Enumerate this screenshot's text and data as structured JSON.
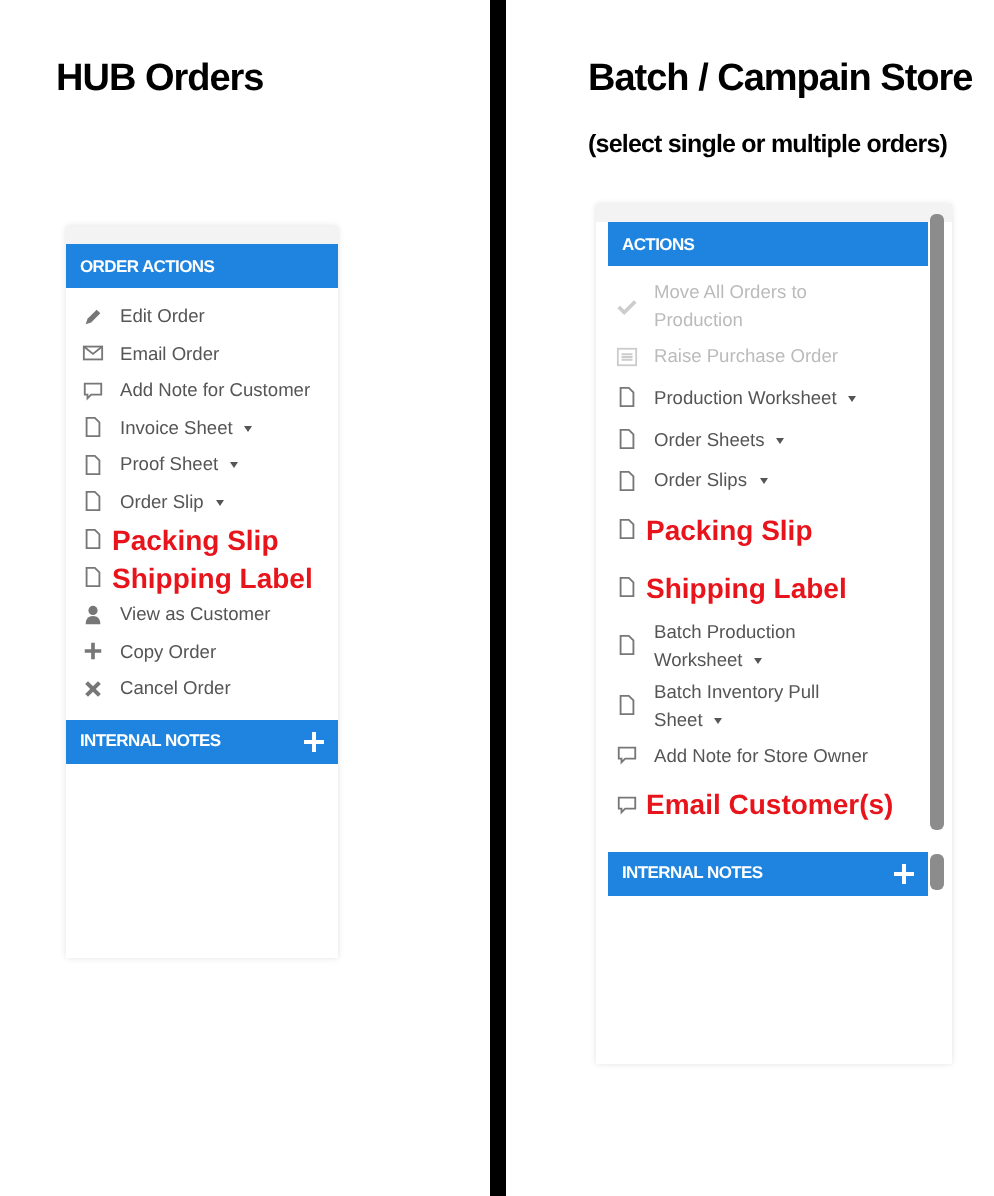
{
  "hub": {
    "title": "HUB Orders",
    "panel": {
      "header": "ORDER ACTIONS",
      "items": [
        {
          "kind": "pencil",
          "label": "Edit Order",
          "has_menu": false,
          "emphasis": false,
          "disabled": false
        },
        {
          "kind": "envelope",
          "label": "Email Order",
          "has_menu": false,
          "emphasis": false,
          "disabled": false
        },
        {
          "kind": "comment",
          "label": "Add Note for Customer",
          "has_menu": false,
          "emphasis": false,
          "disabled": false
        },
        {
          "kind": "document",
          "label": "Invoice Sheet",
          "has_menu": true,
          "emphasis": false,
          "disabled": false
        },
        {
          "kind": "document",
          "label": "Proof Sheet",
          "has_menu": true,
          "emphasis": false,
          "disabled": false
        },
        {
          "kind": "document",
          "label": "Order Slip",
          "has_menu": true,
          "emphasis": false,
          "disabled": false
        },
        {
          "kind": "document",
          "label": "Packing Slip",
          "has_menu": false,
          "emphasis": true,
          "disabled": false
        },
        {
          "kind": "document",
          "label": "Shipping Label",
          "has_menu": false,
          "emphasis": true,
          "disabled": false
        },
        {
          "kind": "user",
          "label": "View as Customer",
          "has_menu": false,
          "emphasis": false,
          "disabled": false
        },
        {
          "kind": "plus",
          "label": "Copy Order",
          "has_menu": false,
          "emphasis": false,
          "disabled": false
        },
        {
          "kind": "cross",
          "label": "Cancel Order",
          "has_menu": false,
          "emphasis": false,
          "disabled": false
        }
      ],
      "notes_header": "INTERNAL NOTES"
    }
  },
  "batch": {
    "title": "Batch / Campain Store",
    "subtitle": "(select single or multiple orders)",
    "panel": {
      "header": "ACTIONS",
      "items": [
        {
          "kind": "check",
          "label": "Move All Orders to Production",
          "has_menu": false,
          "emphasis": false,
          "disabled": true
        },
        {
          "kind": "list",
          "label": "Raise Purchase Order",
          "has_menu": false,
          "emphasis": false,
          "disabled": true
        },
        {
          "kind": "document",
          "label": "Production Worksheet",
          "has_menu": true,
          "emphasis": false,
          "disabled": false
        },
        {
          "kind": "document",
          "label": "Order Sheets",
          "has_menu": true,
          "emphasis": false,
          "disabled": false
        },
        {
          "kind": "document",
          "label": "Order Slips",
          "has_menu": true,
          "emphasis": false,
          "disabled": false
        },
        {
          "kind": "document",
          "label": "Packing Slip",
          "has_menu": false,
          "emphasis": true,
          "disabled": false
        },
        {
          "kind": "document",
          "label": "Shipping Label",
          "has_menu": false,
          "emphasis": true,
          "disabled": false
        },
        {
          "kind": "document",
          "label": "Batch Production Worksheet",
          "has_menu": true,
          "emphasis": false,
          "disabled": false
        },
        {
          "kind": "document",
          "label": "Batch Inventory Pull Sheet",
          "has_menu": true,
          "emphasis": false,
          "disabled": false
        },
        {
          "kind": "comment",
          "label": "Add Note for Store Owner",
          "has_menu": false,
          "emphasis": false,
          "disabled": false
        },
        {
          "kind": "comment",
          "label": "Email Customer(s)",
          "has_menu": false,
          "emphasis": true,
          "disabled": false
        }
      ],
      "notes_header": "INTERNAL NOTES"
    }
  }
}
